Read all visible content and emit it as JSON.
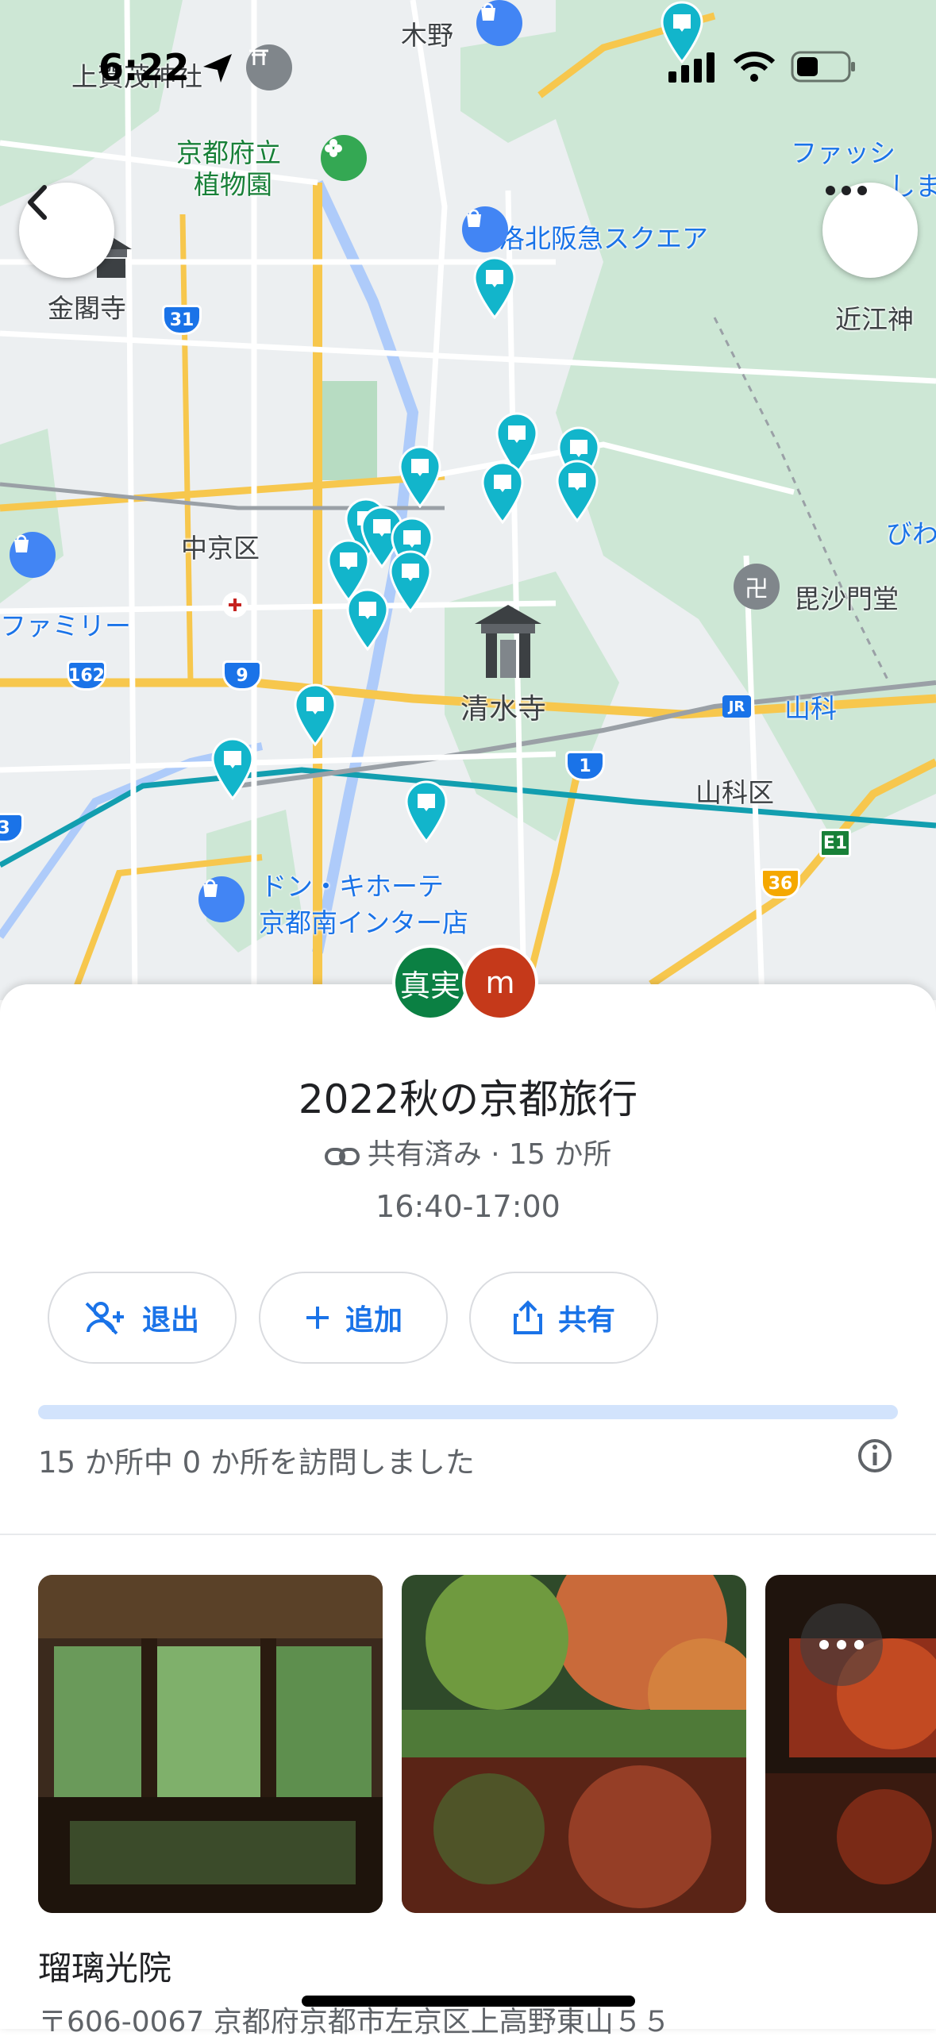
{
  "status_bar": {
    "time": "6:22"
  },
  "map": {
    "labels": {
      "kino": "木野",
      "botanical_1": "京都府立",
      "botanical_2": "植物園",
      "rakuhoku": "洛北阪急スクエア",
      "kinkakuji": "金閣寺",
      "fashion_1": "ファッシ",
      "fashion_2": "しま",
      "omi": "近江神",
      "nakagyo": "中京区",
      "family": "ファミリー",
      "bishamon": "毘沙門堂",
      "kiyomizu": "清水寺",
      "yamashina_st": "山科",
      "yamashina_ku": "山科区",
      "donki_1": "ドン・キホーテ",
      "donki_2": "京都南インター店",
      "biwa": "びわ",
      "jr": "JR",
      "kamigamo": "上賀茂神社"
    },
    "shields": {
      "r31": "31",
      "r162": "162",
      "r9": "9",
      "r1": "1",
      "r36": "36",
      "e1": "E1",
      "r3": "3"
    }
  },
  "sheet": {
    "avatars": [
      {
        "label": "真実",
        "color": "#0b8043"
      },
      {
        "label": "m",
        "color": "#c5391a"
      }
    ],
    "title": "2022秋の京都旅行",
    "shared": "共有済み · 15 か所",
    "time_range": "16:40-17:00",
    "buttons": {
      "leave": "退出",
      "add": "追加",
      "share": "共有"
    },
    "progress": {
      "visited": 0,
      "total": 15
    },
    "visited_text": "15 か所中 0 か所を訪問しました",
    "place_name": "瑠璃光院",
    "address": "〒606-0067 京都府京都市左京区上高野東山５５"
  },
  "colors": {
    "accent": "#1a73e8",
    "pin": "#12b5cb",
    "progress_track": "#d2e3fc"
  }
}
